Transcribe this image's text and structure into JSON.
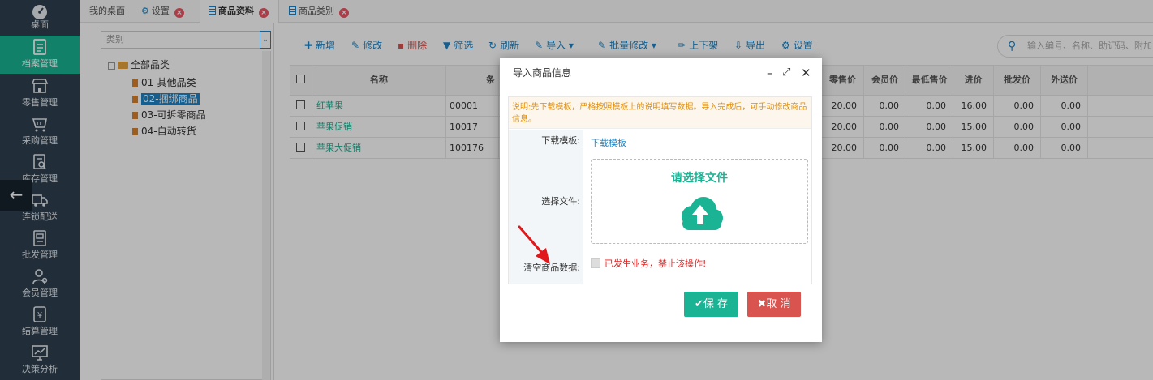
{
  "sidebar": {
    "items": [
      {
        "label": "桌面",
        "icon": "dashboard-icon"
      },
      {
        "label": "档案管理",
        "icon": "archive-icon"
      },
      {
        "label": "零售管理",
        "icon": "store-icon"
      },
      {
        "label": "采购管理",
        "icon": "basket-icon"
      },
      {
        "label": "库存管理",
        "icon": "inventory-icon"
      },
      {
        "label": "连锁配送",
        "icon": "truck-icon"
      },
      {
        "label": "批发管理",
        "icon": "wholesale-icon"
      },
      {
        "label": "会员管理",
        "icon": "member-icon"
      },
      {
        "label": "结算管理",
        "icon": "settlement-icon"
      },
      {
        "label": "决策分析",
        "icon": "analysis-icon"
      }
    ],
    "back_glyph": "←"
  },
  "tabs": [
    {
      "label": "我的桌面"
    },
    {
      "label": "设置"
    },
    {
      "label": "商品资料"
    },
    {
      "label": "商品类别"
    }
  ],
  "category": {
    "select_placeholder": "类别",
    "tree": {
      "root": "全部品类",
      "children": [
        "01-其他品类",
        "02-捆绑商品",
        "03-可拆零商品",
        "04-自动转货"
      ]
    }
  },
  "toolbar": {
    "buttons": [
      {
        "label": "新增",
        "icon": "plus-icon"
      },
      {
        "label": "修改",
        "icon": "edit-icon"
      },
      {
        "label": "删除",
        "icon": "trash-icon"
      },
      {
        "label": "筛选",
        "icon": "filter-icon"
      },
      {
        "label": "刷新",
        "icon": "refresh-icon"
      },
      {
        "label": "导入",
        "icon": "import-icon"
      },
      {
        "label": "批量修改",
        "icon": "batch-edit-icon"
      },
      {
        "label": "上下架",
        "icon": "pencil-icon"
      },
      {
        "label": "导出",
        "icon": "export-icon"
      },
      {
        "label": "设置",
        "icon": "gear-icon"
      }
    ],
    "search_placeholder": "输入编号、名称、助记码、附加"
  },
  "table": {
    "columns": [
      "名称",
      "条",
      "零售价",
      "会员价",
      "最低售价",
      "进价",
      "批发价",
      "外送价"
    ],
    "rows": [
      {
        "name": "红苹果",
        "code": "00001",
        "retail": "20.00",
        "member": "0.00",
        "min": "0.00",
        "cost": "16.00",
        "wholesale": "0.00",
        "delivery": "0.00"
      },
      {
        "name": "苹果促销",
        "code": "10017",
        "retail": "20.00",
        "member": "0.00",
        "min": "0.00",
        "cost": "15.00",
        "wholesale": "0.00",
        "delivery": "0.00"
      },
      {
        "name": "苹果大促销",
        "code": "100176",
        "retail": "20.00",
        "member": "0.00",
        "min": "0.00",
        "cost": "15.00",
        "wholesale": "0.00",
        "delivery": "0.00"
      }
    ]
  },
  "dialog": {
    "title": "导入商品信息",
    "notice": "说明:先下载模板，严格按照模板上的说明填写数据。导入完成后，可手动修改商品信息。",
    "download_label": "下载模板:",
    "download_link": "下载模板",
    "file_label": "选择文件:",
    "upload_text": "请选择文件",
    "clear_label": "清空商品数据:",
    "clear_warning": "已发生业务，禁止该操作!",
    "save": "✔保 存",
    "cancel": "✖取 消"
  },
  "colors": {
    "accent": "#1ab394",
    "primary": "#1c84c6",
    "danger": "#d9534f",
    "sidebar": "#2f4050"
  }
}
